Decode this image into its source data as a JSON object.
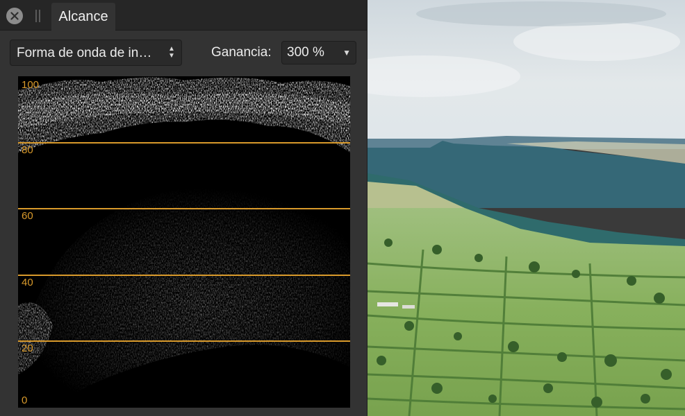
{
  "panel": {
    "tab_label": "Alcance",
    "mode_select": {
      "value": "Forma de onda de in…"
    },
    "gain": {
      "label": "Ganancia:",
      "value": "300 %"
    }
  },
  "scope": {
    "line_color": "#d99a2b",
    "tick_labels": [
      "100",
      "80",
      "60",
      "40",
      "20",
      "0"
    ]
  },
  "icons": {
    "close": "close-icon",
    "grip": "grip-icon",
    "stepper": "updown-arrows-icon",
    "dropdown": "chevron-down-icon"
  }
}
